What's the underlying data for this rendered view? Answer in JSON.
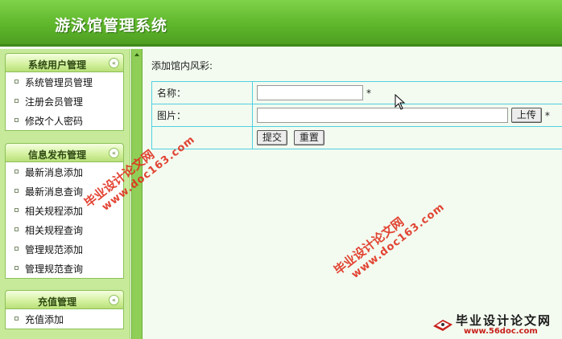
{
  "header": {
    "title": "游泳馆管理系统"
  },
  "sidebar": {
    "panels": [
      {
        "title": "系统用户管理",
        "items": [
          "系统管理员管理",
          "注册会员管理",
          "修改个人密码"
        ]
      },
      {
        "title": "信息发布管理",
        "items": [
          "最新消息添加",
          "最新消息查询",
          "相关规程添加",
          "相关规程查询",
          "管理规范添加",
          "管理规范查询"
        ]
      },
      {
        "title": "充值管理",
        "items": [
          "充值添加"
        ]
      }
    ],
    "toggle_glyph": "«"
  },
  "main": {
    "breadcrumb": "添加馆内风彩:",
    "form": {
      "name_label": "名称：",
      "image_label": "图片：",
      "required_mark": "*",
      "upload_button": "上传",
      "submit_button": "提交",
      "reset_button": "重置",
      "name_value": "",
      "image_value": ""
    }
  },
  "watermarks": {
    "line1": "毕业设计论文网",
    "line2": "www.doc163.com"
  },
  "logo": {
    "text": "毕业设计论文网",
    "url": "www.56doc.com"
  },
  "colors": {
    "header": "#5fb72b",
    "sidebar": "#c6ea9a",
    "form_border": "#4fd0e0",
    "watermark": "#e0301e"
  },
  "icons": {
    "collapse": "double-chevron-up-icon",
    "bullet": "square-bullet-icon",
    "cursor": "mouse-pointer-icon"
  }
}
